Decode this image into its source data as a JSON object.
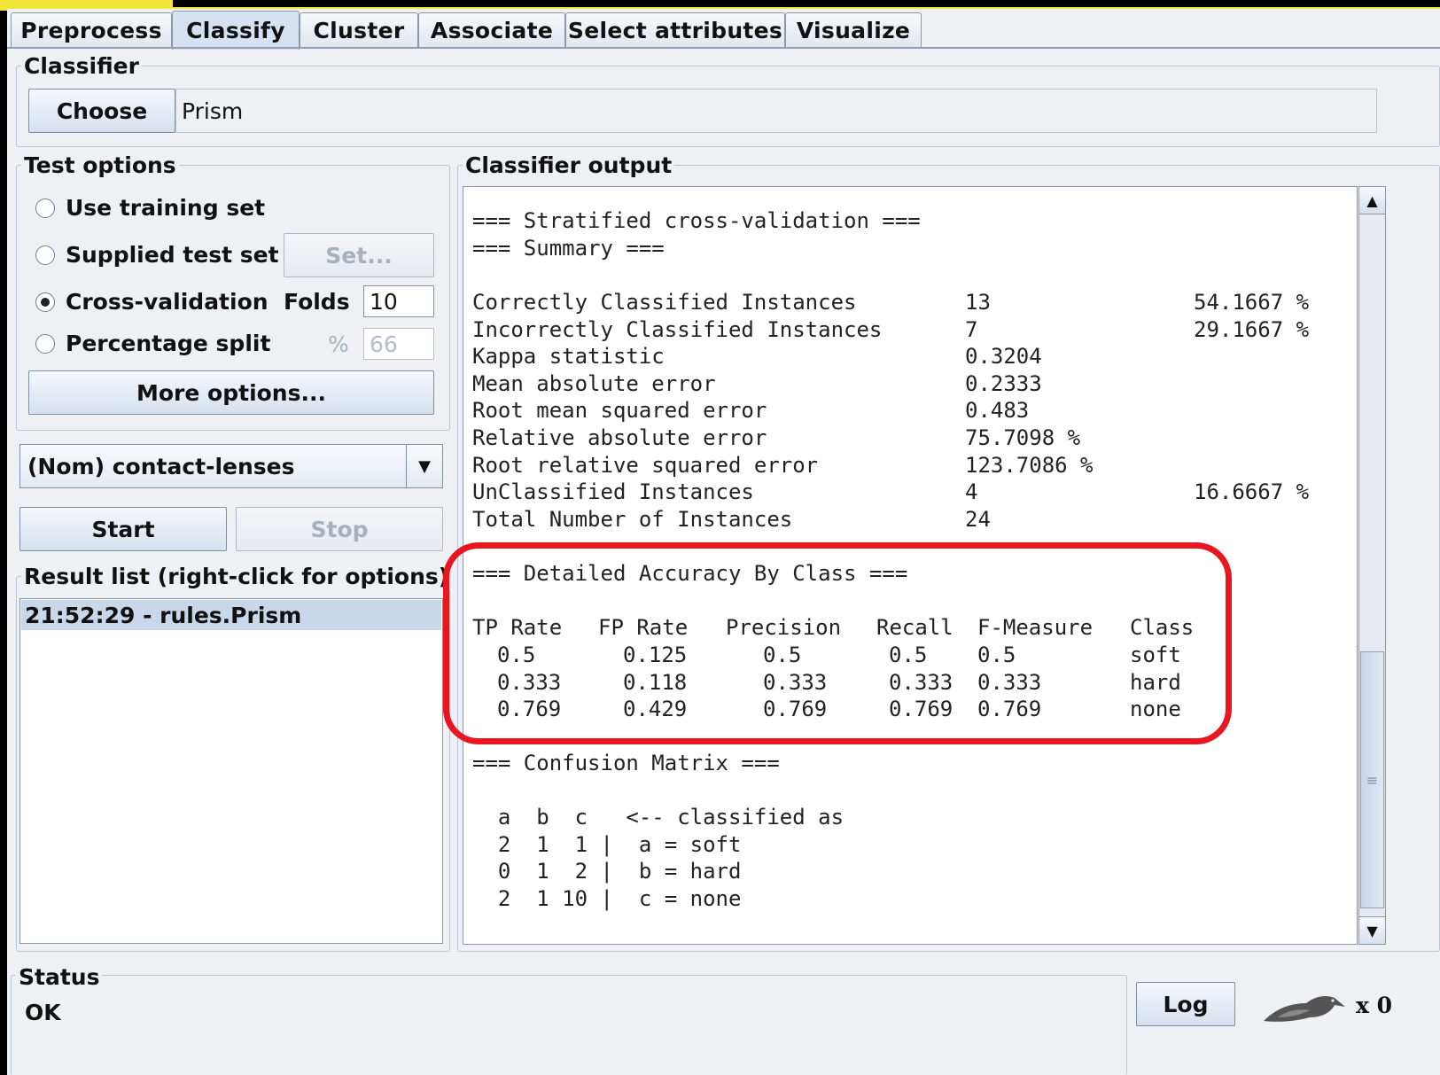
{
  "tabs": [
    "Preprocess",
    "Classify",
    "Cluster",
    "Associate",
    "Select attributes",
    "Visualize"
  ],
  "active_tab": "Classify",
  "classifier": {
    "title": "Classifier",
    "choose_label": "Choose",
    "value": "Prism"
  },
  "test_options": {
    "title": "Test options",
    "use_training_set": "Use training set",
    "supplied_test_set": "Supplied test set",
    "set_button": "Set...",
    "cross_validation": "Cross-validation",
    "folds_label": "Folds",
    "folds_value": "10",
    "percentage_split": "Percentage split",
    "percent_symbol": "%",
    "percent_value": "66",
    "selected": "Cross-validation",
    "more_options": "More options..."
  },
  "class_attribute": "(Nom) contact-lenses",
  "start_label": "Start",
  "stop_label": "Stop",
  "result_list": {
    "title": "Result list (right-click for options)",
    "items": [
      "21:52:29 - rules.Prism"
    ]
  },
  "output": {
    "title": "Classifier output",
    "header_lines": [
      "=== Stratified cross-validation ===",
      "=== Summary ==="
    ],
    "summary": [
      {
        "label": "Correctly Classified Instances",
        "value": "13",
        "pct": "54.1667 %"
      },
      {
        "label": "Incorrectly Classified Instances",
        "value": "7",
        "pct": "29.1667 %"
      },
      {
        "label": "Kappa statistic",
        "value": "0.3204",
        "pct": ""
      },
      {
        "label": "Mean absolute error",
        "value": "0.2333",
        "pct": ""
      },
      {
        "label": "Root mean squared error",
        "value": "0.483",
        "pct": ""
      },
      {
        "label": "Relative absolute error",
        "value": "75.7098 %",
        "pct": ""
      },
      {
        "label": "Root relative squared error",
        "value": "123.7086 %",
        "pct": ""
      },
      {
        "label": "UnClassified Instances",
        "value": "4",
        "pct": "16.6667 %"
      },
      {
        "label": "Total Number of Instances",
        "value": "24",
        "pct": ""
      }
    ],
    "accuracy_title": "=== Detailed Accuracy By Class ===",
    "accuracy_headers": [
      "TP Rate",
      "FP Rate",
      "Precision",
      "Recall",
      "F-Measure",
      "Class"
    ],
    "accuracy_rows": [
      [
        "0.5",
        "0.125",
        "0.5",
        "0.5",
        "0.5",
        "soft"
      ],
      [
        "0.333",
        "0.118",
        "0.333",
        "0.333",
        "0.333",
        "hard"
      ],
      [
        "0.769",
        "0.429",
        "0.769",
        "0.769",
        "0.769",
        "none"
      ]
    ],
    "confusion_title": "=== Confusion Matrix ===",
    "confusion_lines": [
      "  a  b  c   <-- classified as",
      "  2  1  1 |  a = soft",
      "  0  1  2 |  b = hard",
      "  2  1 10 |  c = none"
    ]
  },
  "status": {
    "title": "Status",
    "text": "OK",
    "log_label": "Log",
    "task_count": "x 0"
  },
  "colors": {
    "highlight": "#e8171f",
    "selected_row": "#c8d7ea",
    "accent_yellow": "#f2e63a"
  }
}
